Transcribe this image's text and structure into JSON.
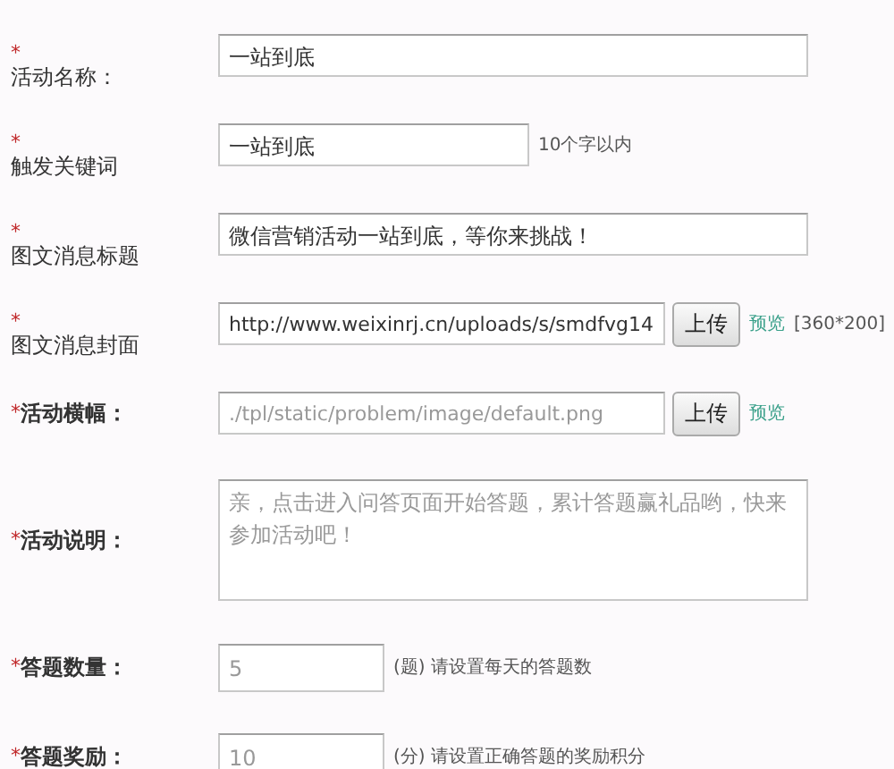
{
  "rows": [
    {
      "kind": "stacked",
      "mark": "*",
      "label": "活动名称：",
      "field": {
        "kind": "text",
        "value": "一站到底"
      }
    },
    {
      "kind": "stacked",
      "mark": "*",
      "label": "触发关键词",
      "field": {
        "kind": "keyword",
        "value": "一站到底"
      },
      "hint": "10个字以内"
    },
    {
      "kind": "stacked",
      "mark": "*",
      "label": "图文消息标题",
      "field": {
        "kind": "text",
        "value": "微信营销活动一站到底，等你来挑战！"
      }
    },
    {
      "kind": "stacked",
      "mark": "*",
      "label": "图文消息封面",
      "field": {
        "kind": "file",
        "value": "http://www.weixinrj.cn/uploads/s/smdfvg14"
      },
      "upload_button": "上传",
      "preview_link": "预览",
      "hint": "[360*200]"
    },
    {
      "kind": "inline",
      "mark": "*",
      "label": "活动横幅：",
      "field": {
        "kind": "file",
        "placeholder": "./tpl/static/problem/image/default.png"
      },
      "upload_button": "上传",
      "preview_link": "预览"
    },
    {
      "kind": "inline",
      "mark": "*",
      "label": "活动说明：",
      "field": {
        "kind": "textarea",
        "placeholder": "亲，点击进入问答页面开始答题，累计答题赢礼品哟，快来参加活动吧！"
      }
    },
    {
      "kind": "inline",
      "mark": "*",
      "label": "答题数量：",
      "field": {
        "kind": "number",
        "placeholder": "5"
      },
      "hint": "(题) 请设置每天的答题数"
    },
    {
      "kind": "inline",
      "mark": "*",
      "label": "答题奖励：",
      "field": {
        "kind": "number",
        "placeholder": "10"
      },
      "hint": "(分) 请设置正确答题的奖励积分"
    }
  ]
}
